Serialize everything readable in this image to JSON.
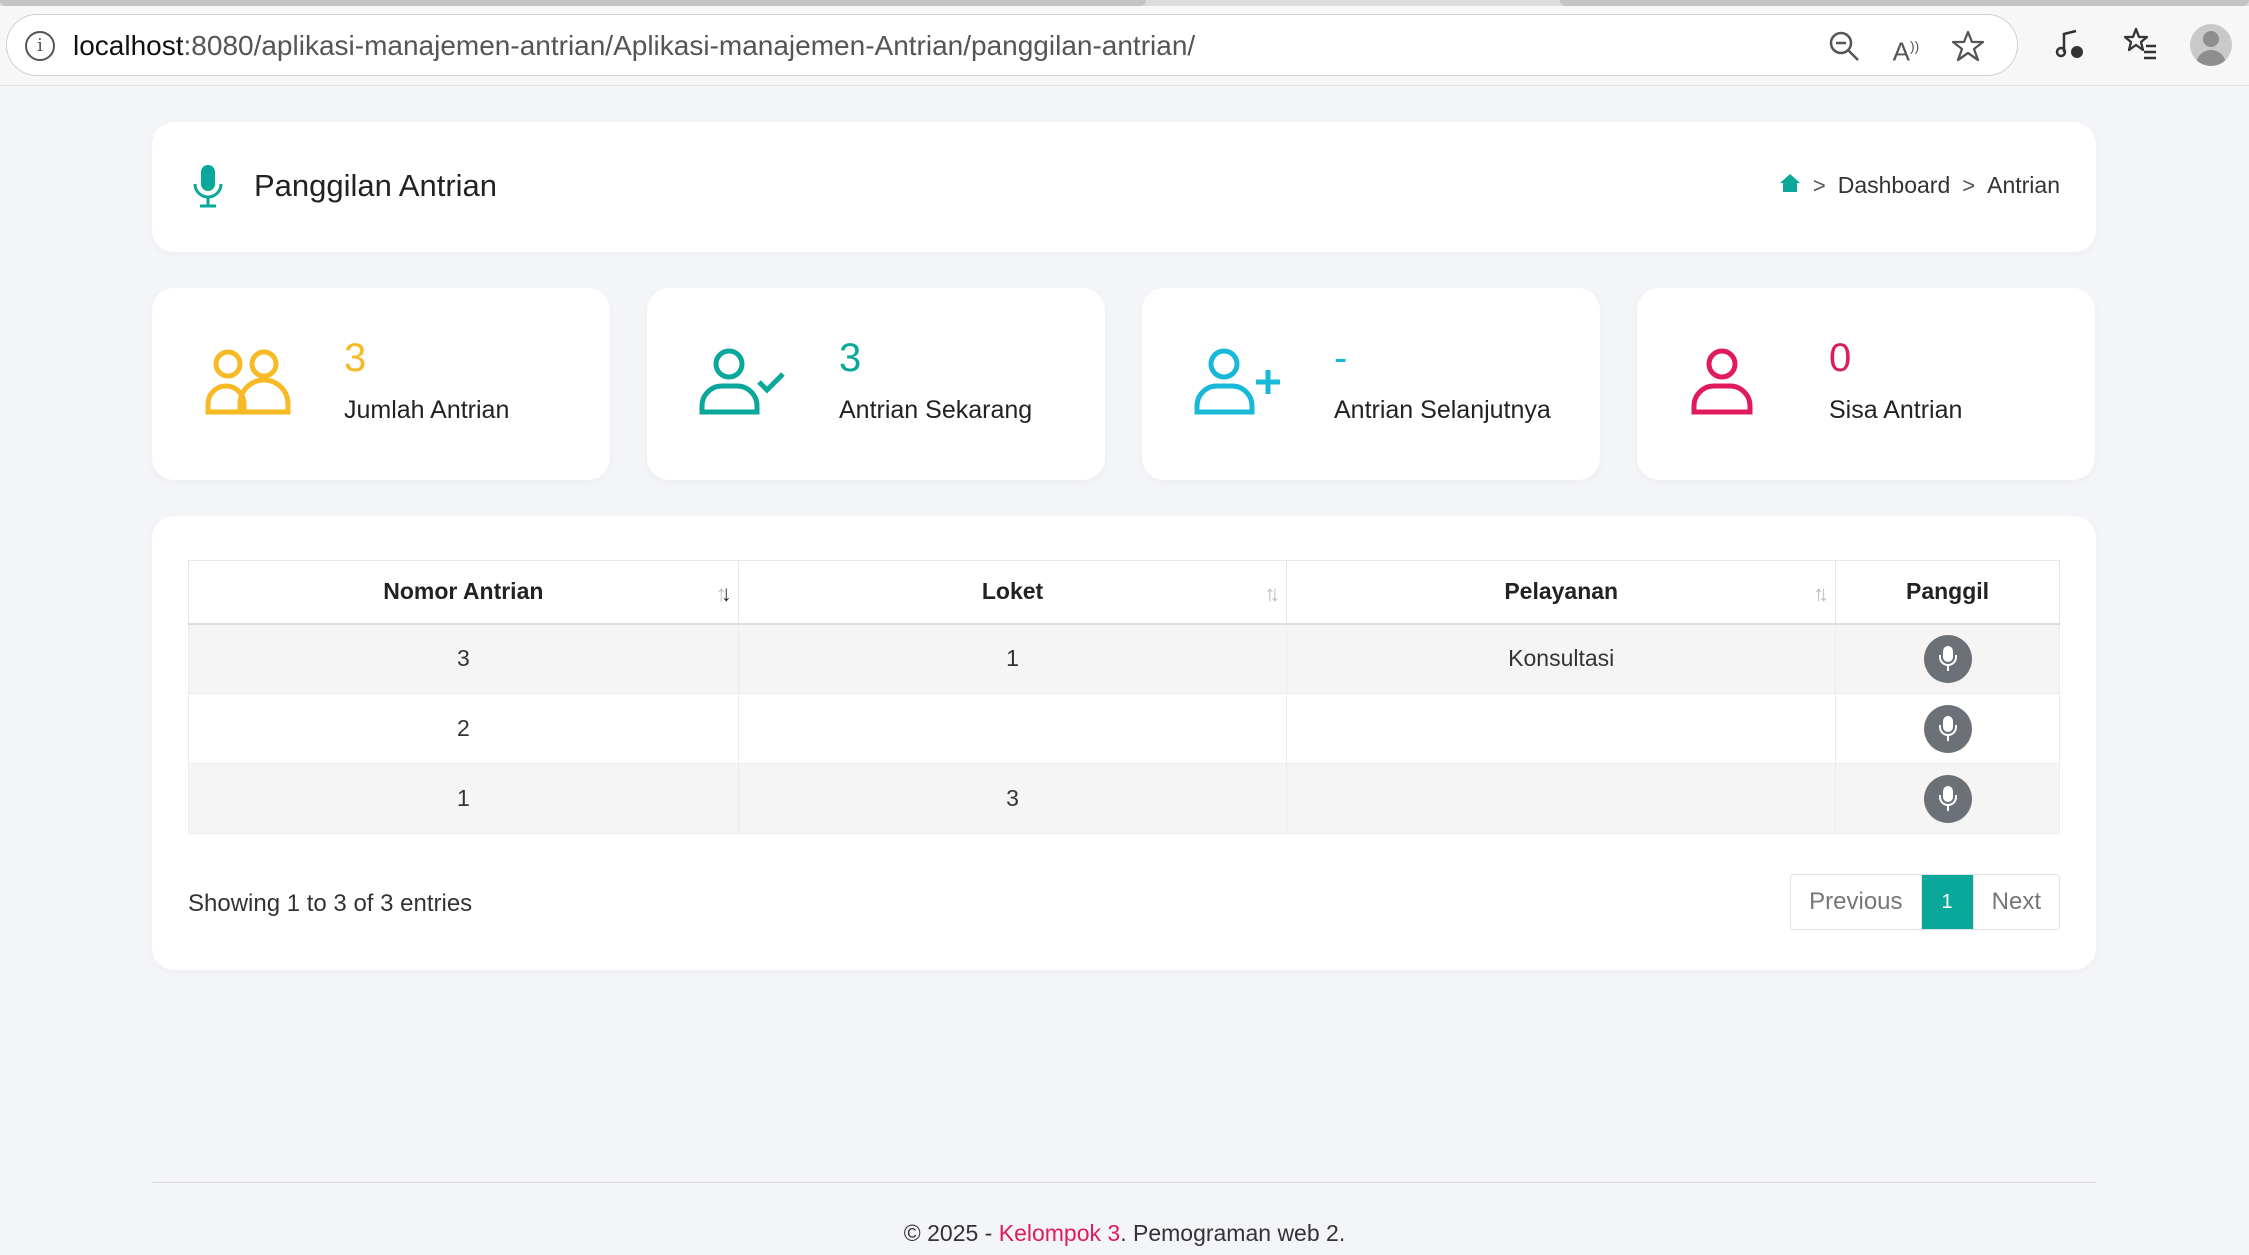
{
  "browser": {
    "url_host": "localhost",
    "url_rest": ":8080/aplikasi-manajemen-antrian/Aplikasi-manajemen-Antrian/panggilan-antrian/",
    "icons": [
      "info-icon",
      "zoom-out-icon",
      "read-aloud-icon",
      "favorite-star-icon",
      "media-control-icon",
      "favorites-list-icon",
      "profile-avatar"
    ]
  },
  "header": {
    "title": "Panggilan Antrian",
    "breadcrumb": [
      "Dashboard",
      "Antrian"
    ],
    "sep": ">"
  },
  "stats": [
    {
      "value": "3",
      "label": "Jumlah Antrian",
      "color": "#f7b924",
      "icon": "users-icon"
    },
    {
      "value": "3",
      "label": "Antrian Sekarang",
      "color": "#0aa89a",
      "icon": "user-check-icon"
    },
    {
      "value": "-",
      "label": "Antrian Selanjutnya",
      "color": "#17b8d8",
      "icon": "user-plus-icon"
    },
    {
      "value": "0",
      "label": "Sisa Antrian",
      "color": "#e01b5b",
      "icon": "user-icon"
    }
  ],
  "table": {
    "headers": [
      "Nomor Antrian",
      "Loket",
      "Pelayanan",
      "Panggil"
    ],
    "rows": [
      {
        "nomor": "3",
        "loket": "1",
        "pelayanan": "Konsultasi"
      },
      {
        "nomor": "2",
        "loket": "",
        "pelayanan": ""
      },
      {
        "nomor": "1",
        "loket": "3",
        "pelayanan": ""
      }
    ],
    "info": "Showing 1 to 3 of 3 entries",
    "pager": {
      "previous": "Previous",
      "current": "1",
      "next": "Next"
    }
  },
  "footer": {
    "prefix": "© 2025 - ",
    "team": "Kelompok 3",
    "suffix": ". Pemograman web 2."
  },
  "colors": {
    "accent": "#0aa89a",
    "danger": "#e01b5b"
  }
}
